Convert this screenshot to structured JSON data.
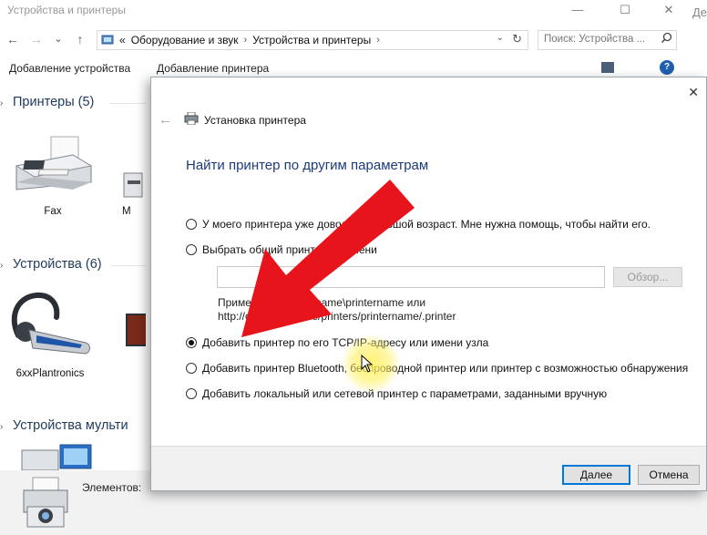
{
  "explorer": {
    "title": "Устройства и принтеры",
    "window_controls": {
      "minimize": "—",
      "maximize": "☐",
      "close": "✕",
      "edge_text": "Де"
    },
    "nav": {
      "back": "←",
      "forward": "→",
      "recent": "⌄",
      "up": "↑"
    },
    "address": {
      "prefix": "«",
      "crumbs": [
        "Оборудование и звук",
        "Устройства и принтеры"
      ],
      "separator": "›",
      "dropdown": "⌄",
      "refresh": "↻"
    },
    "search": {
      "placeholder": "Поиск: Устройства ...",
      "icon": "search-icon"
    },
    "commands": {
      "add_device": "Добавление устройства",
      "add_printer": "Добавление принтера",
      "help": "?"
    },
    "groups": [
      {
        "label": "Принтеры (5)",
        "chevron": "›"
      },
      {
        "label": "Устройства (6)",
        "chevron": "›"
      },
      {
        "label": "Устройства мульти",
        "chevron": "›"
      }
    ],
    "devices": {
      "fax": "Fax",
      "printer_partial": "M",
      "plantronics": "6xxPlantronics"
    },
    "status": {
      "items_label": "Элементов:"
    }
  },
  "dialog": {
    "close": "✕",
    "back": "←",
    "title": "Установка принтера",
    "heading": "Найти принтер по другим параметрам",
    "options": [
      {
        "label": "У моего принтера уже довольно большой возраст. Мне нужна помощь, чтобы найти его.",
        "checked": false
      },
      {
        "label": "Выбрать общий принтер по имени",
        "checked": false
      },
      {
        "label": "Добавить принтер по его TCP/IP-адресу или имени узла",
        "checked": true
      },
      {
        "label": "Добавить принтер Bluetooth, беспроводной принтер или принтер с возможностью обнаружения",
        "checked": false
      },
      {
        "label": "Добавить локальный или сетевой принтер с параметрами, заданными вручную",
        "checked": false
      }
    ],
    "share_input_value": "",
    "browse_button": "Обзор...",
    "example_line1": "Пример: \\\\computername\\printername или",
    "example_line2": "http://computername/printers/printername/.printer",
    "next_button": "Далее",
    "cancel_button": "Отмена"
  },
  "colors": {
    "arrow": "#e8141b",
    "heading": "#1d3b7a",
    "group_header": "#1e395b",
    "highlight": "#fff05a"
  }
}
